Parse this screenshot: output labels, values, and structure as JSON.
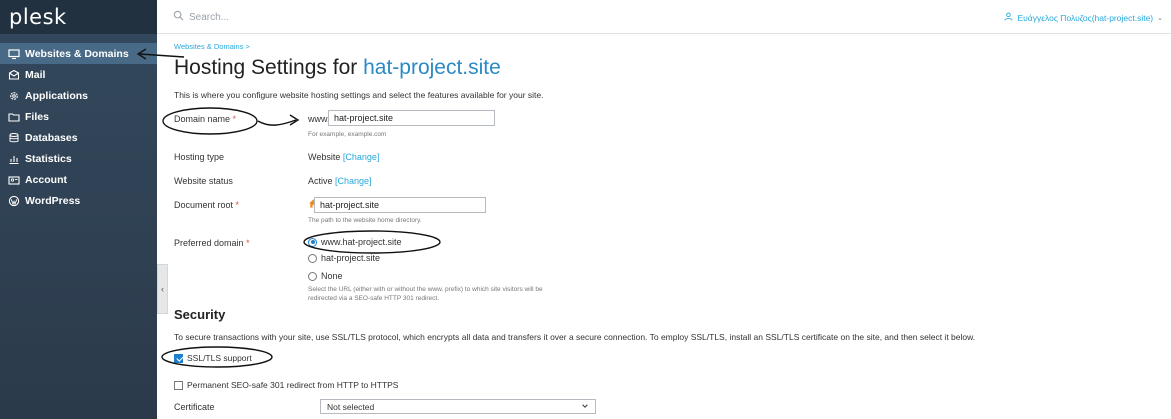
{
  "sidebar": {
    "logo": "plesk",
    "items": [
      {
        "label": "Websites & Domains",
        "icon": "monitor-icon"
      },
      {
        "label": "Mail",
        "icon": "mail-icon"
      },
      {
        "label": "Applications",
        "icon": "gear-icon"
      },
      {
        "label": "Files",
        "icon": "folder-icon"
      },
      {
        "label": "Databases",
        "icon": "database-icon"
      },
      {
        "label": "Statistics",
        "icon": "chart-icon"
      },
      {
        "label": "Account",
        "icon": "account-icon"
      },
      {
        "label": "WordPress",
        "icon": "wordpress-icon"
      }
    ],
    "collapse_glyph": "‹"
  },
  "topbar": {
    "search_placeholder": "Search...",
    "user": "Ευάγγελος Πολυζος(hat-project.site)"
  },
  "main": {
    "breadcrumb": "Websites & Domains  >",
    "title_prefix": "Hosting Settings for ",
    "title_domain": "hat-project.site",
    "intro": "This is where you configure website hosting settings and select the features available for your site.",
    "domain_name": {
      "label": "Domain name",
      "required": "*",
      "prefix": "www.",
      "value": "hat-project.site",
      "hint": "For example, example.com"
    },
    "hosting_type": {
      "label": "Hosting type",
      "value": "Website",
      "link": "[Change]"
    },
    "website_status": {
      "label": "Website status",
      "value": "Active",
      "link": "[Change]"
    },
    "document_root": {
      "label": "Document root",
      "required": "*",
      "slash": "/",
      "value": "hat-project.site",
      "hint": "The path to the website home directory."
    },
    "preferred_domain": {
      "label": "Preferred domain",
      "required": "*",
      "options": [
        "www.hat-project.site",
        "hat-project.site",
        "None"
      ],
      "selected": "www.hat-project.site",
      "hint_line1": "Select the URL (either with or without the www. prefix) to which site visitors will be",
      "hint_line2": "redirected via a SEO-safe HTTP 301 redirect."
    },
    "security": {
      "heading": "Security",
      "text": "To secure transactions with your site, use SSL/TLS protocol, which encrypts all data and transfers it over a secure connection. To employ SSL/TLS, install an SSL/TLS certificate on the site, and then select it below.",
      "ssl_support": {
        "label": "SSL/TLS support",
        "checked": true
      },
      "redirect": {
        "label": "Permanent SEO-safe 301 redirect from HTTP to HTTPS",
        "checked": false
      },
      "certificate": {
        "label": "Certificate",
        "value": "Not selected"
      }
    }
  },
  "colors": {
    "sidebar": "#34495e",
    "active_item": "#486a86",
    "link": "#28a8dc",
    "accent": "#1e7fd0",
    "required": "#d9534f"
  }
}
